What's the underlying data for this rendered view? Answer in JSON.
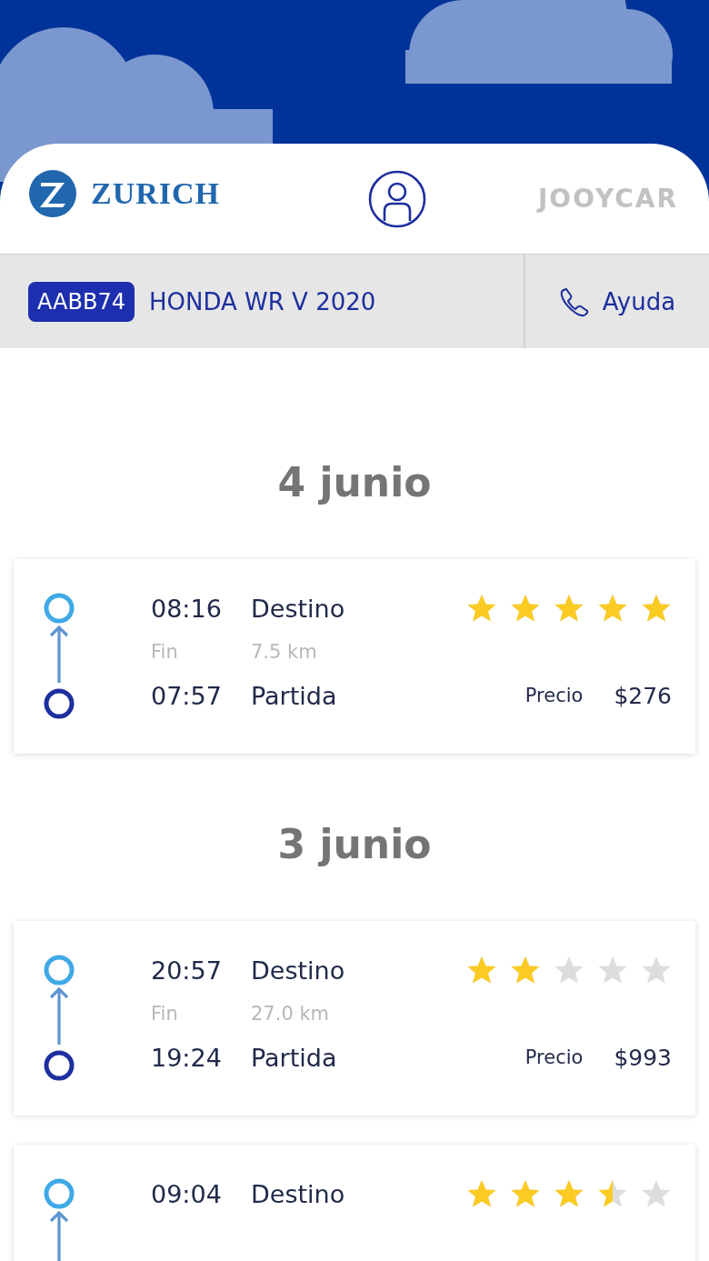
{
  "header": {
    "insurer_logo": "ZURICH",
    "partner_logo": "JOOYCAR"
  },
  "vehicle_bar": {
    "plate": "AABB74",
    "model": "HONDA WR V 2020",
    "help": "Ayuda"
  },
  "days": [
    {
      "date": "4 junio",
      "trips": [
        {
          "end_time": "08:16",
          "end_label": "Destino",
          "stars": 5,
          "fin_label": "Fin",
          "distance": "7.5 km",
          "start_time": "07:57",
          "start_label": "Partida",
          "price_label": "Precio",
          "price": "$276"
        }
      ]
    },
    {
      "date": "3 junio",
      "trips": [
        {
          "end_time": "20:57",
          "end_label": "Destino",
          "stars": 2,
          "fin_label": "Fin",
          "distance": "27.0 km",
          "start_time": "19:24",
          "start_label": "Partida",
          "price_label": "Precio",
          "price": "$993"
        },
        {
          "end_time": "09:04",
          "end_label": "Destino",
          "stars": 3.5
        }
      ]
    }
  ]
}
